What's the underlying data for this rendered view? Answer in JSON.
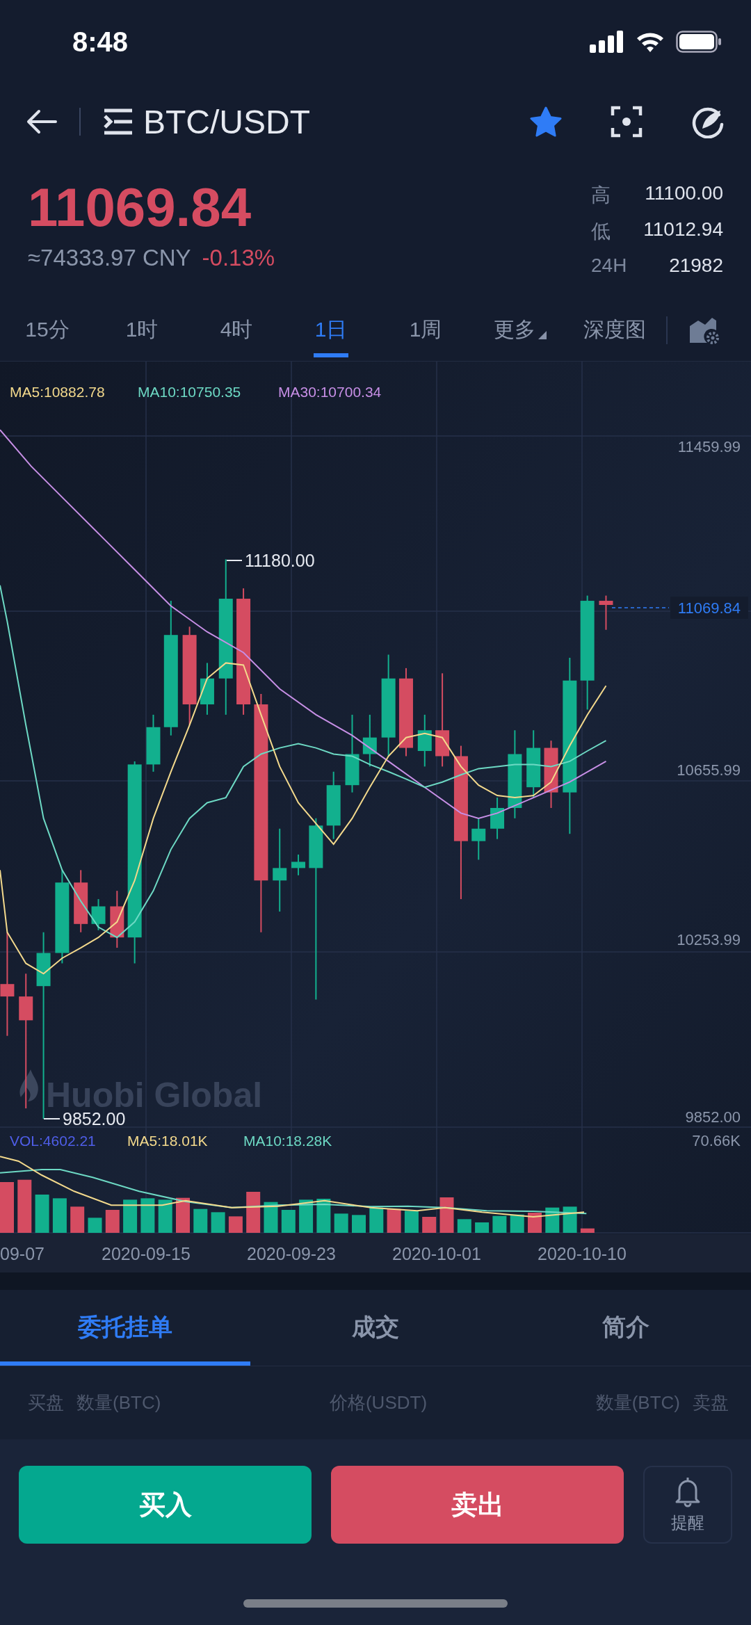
{
  "status_bar": {
    "time": "8:48"
  },
  "header": {
    "title": "BTC/USDT",
    "favorite": true
  },
  "price": {
    "last": "11069.84",
    "cny": "≈74333.97 CNY",
    "change": "-0.13%"
  },
  "stats": [
    {
      "label": "高",
      "value": "11100.00"
    },
    {
      "label": "低",
      "value": "11012.94"
    },
    {
      "label": "24H",
      "value": "21982"
    }
  ],
  "timeframe_tabs": [
    {
      "label": "15分",
      "selected": false,
      "kind": "plain"
    },
    {
      "label": "1时",
      "selected": false,
      "kind": "plain"
    },
    {
      "label": "4时",
      "selected": false,
      "kind": "plain"
    },
    {
      "label": "1日",
      "selected": true,
      "kind": "plain"
    },
    {
      "label": "1周",
      "selected": false,
      "kind": "plain"
    },
    {
      "label": "更多",
      "selected": false,
      "kind": "dropdown"
    },
    {
      "label": "深度图",
      "selected": false,
      "kind": "plain"
    }
  ],
  "chart": {
    "ma_labels": [
      {
        "text": "MA5:10882.78",
        "color": "#f3d98c"
      },
      {
        "text": "MA10:10750.35",
        "color": "#6dd9c4"
      },
      {
        "text": "MA30:10700.34",
        "color": "#c78fe6"
      }
    ],
    "price_axis": [
      "11459.99",
      "10655.99",
      "10253.99",
      "9852.00"
    ],
    "high_marker": "11180.00",
    "low_marker": "9852.00",
    "current_price": "11069.84",
    "watermark": "Huobi Global",
    "volume": {
      "labels": [
        {
          "text": "VOL:4602.21",
          "color": "#4f5ee8"
        },
        {
          "text": "MA5:18.01K",
          "color": "#f3d98c"
        },
        {
          "text": "MA10:18.28K",
          "color": "#6dd9c4"
        }
      ],
      "max": "70.66K"
    },
    "dates": [
      "09-07",
      "2020-09-15",
      "2020-09-23",
      "2020-10-01",
      "2020-10-10"
    ]
  },
  "detail_tabs": [
    {
      "label": "委托挂单",
      "selected": true
    },
    {
      "label": "成交",
      "selected": false
    },
    {
      "label": "简介",
      "selected": false
    }
  ],
  "order_header": {
    "left": [
      "买盘",
      "数量(BTC)"
    ],
    "center": "价格(USDT)",
    "right": [
      "数量(BTC)",
      "卖盘"
    ]
  },
  "actions": {
    "buy": "买入",
    "sell": "卖出",
    "alert": "提醒"
  }
}
